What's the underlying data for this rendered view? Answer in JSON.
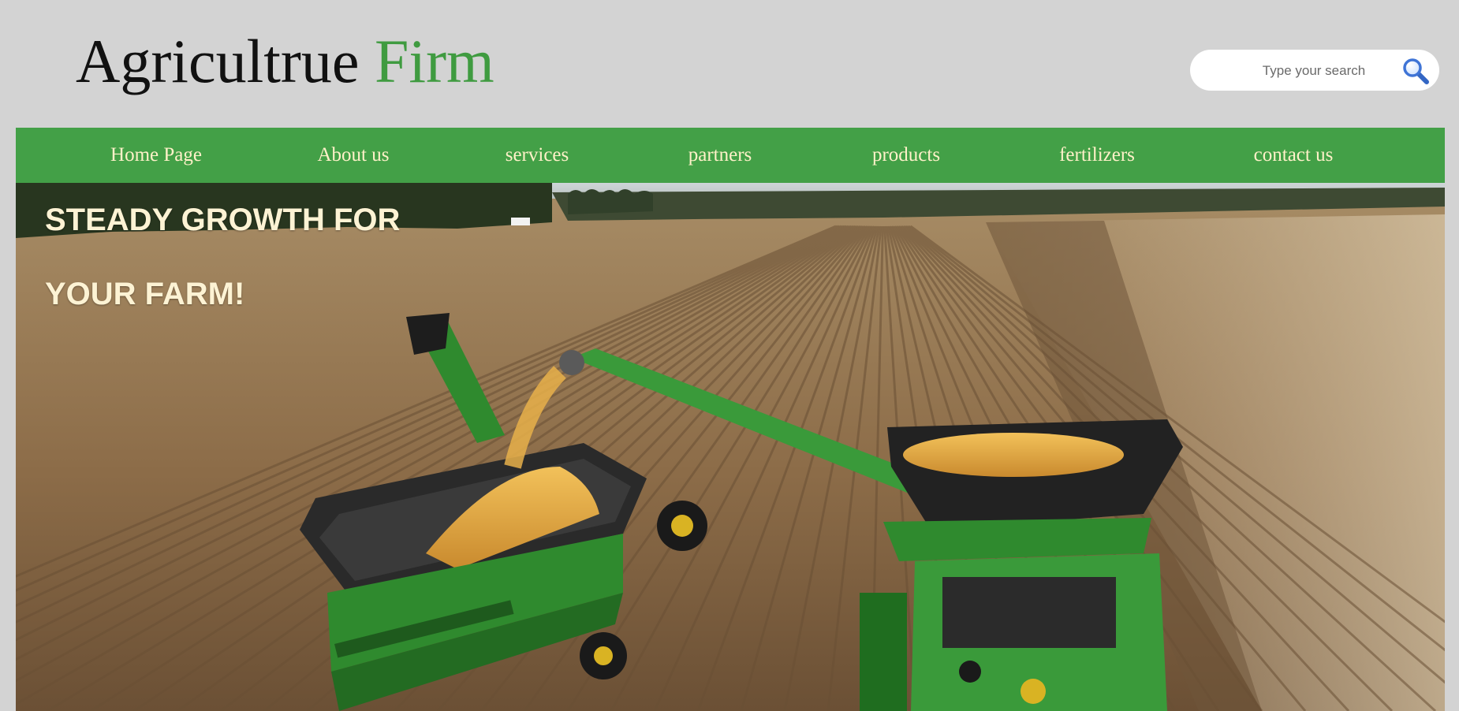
{
  "header": {
    "logo_main": "Agricultrue",
    "logo_accent": "Firm",
    "search_placeholder": "Type your search",
    "search_icon": "magnifier-icon"
  },
  "nav": {
    "items": [
      {
        "label": "Home Page"
      },
      {
        "label": "About us"
      },
      {
        "label": "services"
      },
      {
        "label": "partners"
      },
      {
        "label": "products"
      },
      {
        "label": "fertilizers"
      },
      {
        "label": "contact us"
      }
    ]
  },
  "hero": {
    "title_line1": "STEADY GROWTH FOR",
    "title_line2": "YOUR FARM!",
    "image": "harvest-field-photo"
  },
  "colors": {
    "page_bg": "#d3d3d3",
    "brand_green": "#43a047",
    "accent_text": "#3f9b40",
    "nav_text": "#fff1c9",
    "hero_text": "#fdf3d4"
  }
}
